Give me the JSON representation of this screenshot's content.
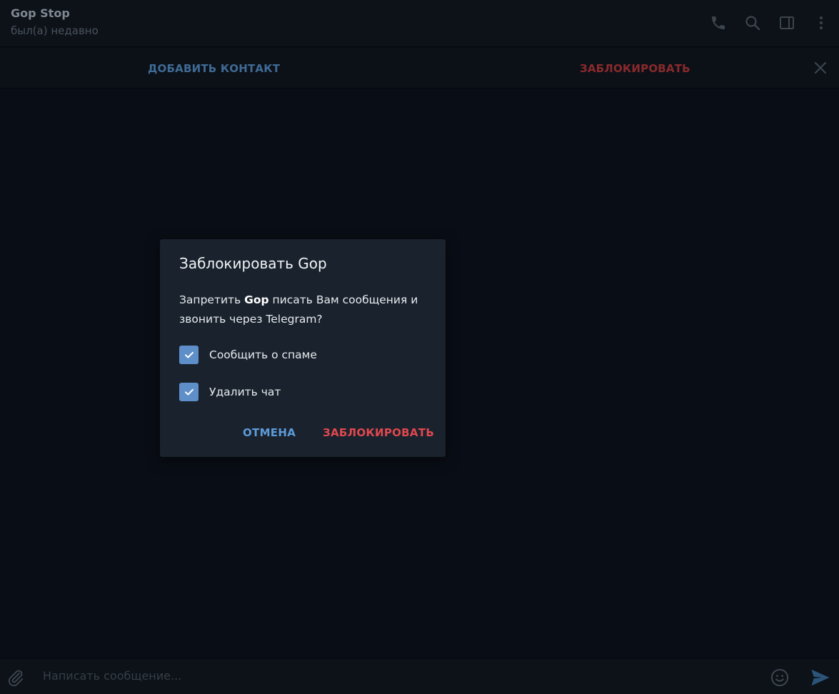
{
  "header": {
    "title": "Gop Stop",
    "status": "был(а) недавно",
    "icons": [
      "phone-icon",
      "search-icon",
      "sidebar-toggle-icon",
      "more-vertical-icon"
    ]
  },
  "action_bar": {
    "add_contact": "ДОБАВИТЬ КОНТАКТ",
    "block": "ЗАБЛОКИРОВАТЬ",
    "close_icon": "close-icon"
  },
  "dialog": {
    "title": "Заблокировать Gop",
    "text_before": "Запретить ",
    "text_name": "Gop",
    "text_after": " писать Вам сообщения и звонить через Telegram?",
    "checkboxes": [
      {
        "label": "Сообщить о спаме",
        "checked": true
      },
      {
        "label": "Удалить чат",
        "checked": true
      }
    ],
    "cancel_label": "ОТМЕНА",
    "block_label": "ЗАБЛОКИРОВАТЬ"
  },
  "composer": {
    "placeholder": "Написать сообщение...",
    "icons": [
      "attach-icon",
      "emoji-icon",
      "send-icon"
    ]
  },
  "colors": {
    "background": "#090d15",
    "dialog_bg": "#19222d",
    "accent_blue": "#5e9bd9",
    "accent_red": "#e0484e",
    "checkbox": "#5e8fc9"
  }
}
